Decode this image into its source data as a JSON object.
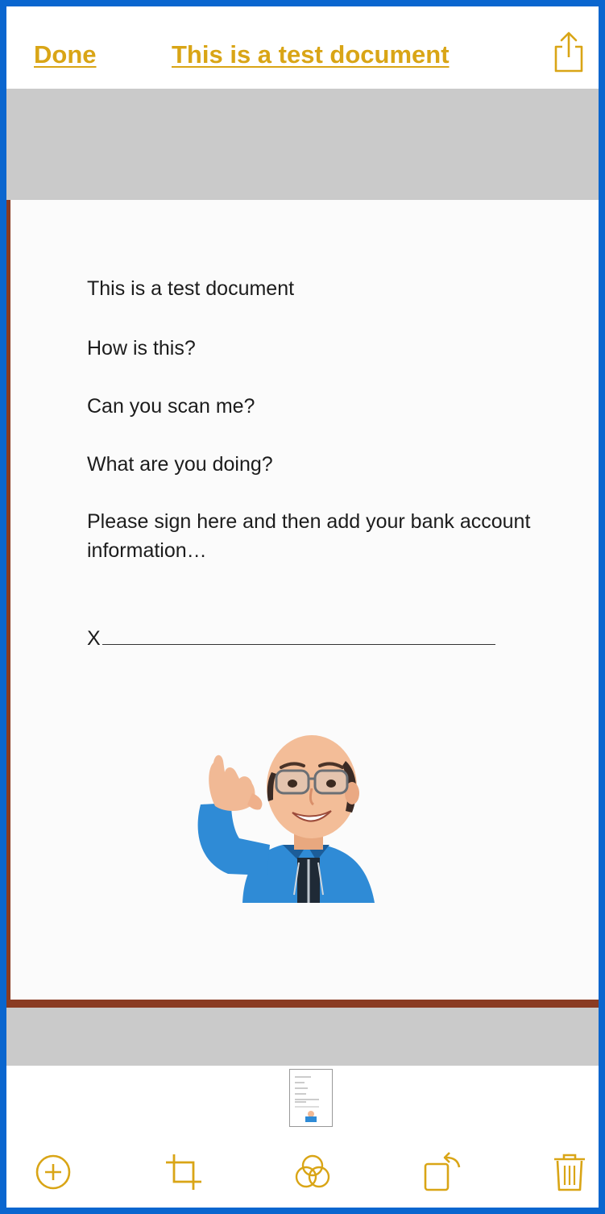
{
  "nav": {
    "done_label": "Done",
    "title": "This is a test document",
    "share_icon": "share-icon"
  },
  "document": {
    "lines": [
      "This is a test document",
      "How is this?",
      "Can you scan me?",
      "What are you doing?",
      "Please sign here and then add your bank account information…"
    ],
    "signature_prefix": "X"
  },
  "toolbar": {
    "icons": [
      "add-icon",
      "crop-icon",
      "filter-icon",
      "rotate-icon",
      "trash-icon"
    ]
  },
  "colors": {
    "accent": "#d9a516",
    "frame": "#0a66cf",
    "gray_band": "#cacaca"
  }
}
